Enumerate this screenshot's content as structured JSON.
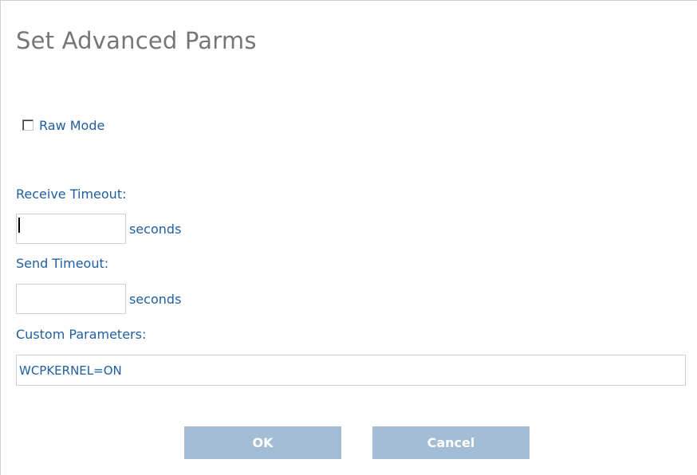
{
  "dialog": {
    "title": "Set Advanced Parms"
  },
  "raw_mode": {
    "label": "Raw Mode",
    "checked": false
  },
  "receive_timeout": {
    "label": "Receive Timeout:",
    "value": "",
    "unit": "seconds"
  },
  "send_timeout": {
    "label": "Send Timeout:",
    "value": "",
    "unit": "seconds"
  },
  "custom_parameters": {
    "label": "Custom Parameters:",
    "value": "WCPKERNEL=ON"
  },
  "buttons": {
    "ok_label": "OK",
    "cancel_label": "Cancel"
  },
  "colors": {
    "label_text": "#1f5fa0",
    "title_text": "#767676",
    "button_bg": "#a3bdd4",
    "button_text": "#ffffff",
    "input_border": "#cfcfcf"
  }
}
